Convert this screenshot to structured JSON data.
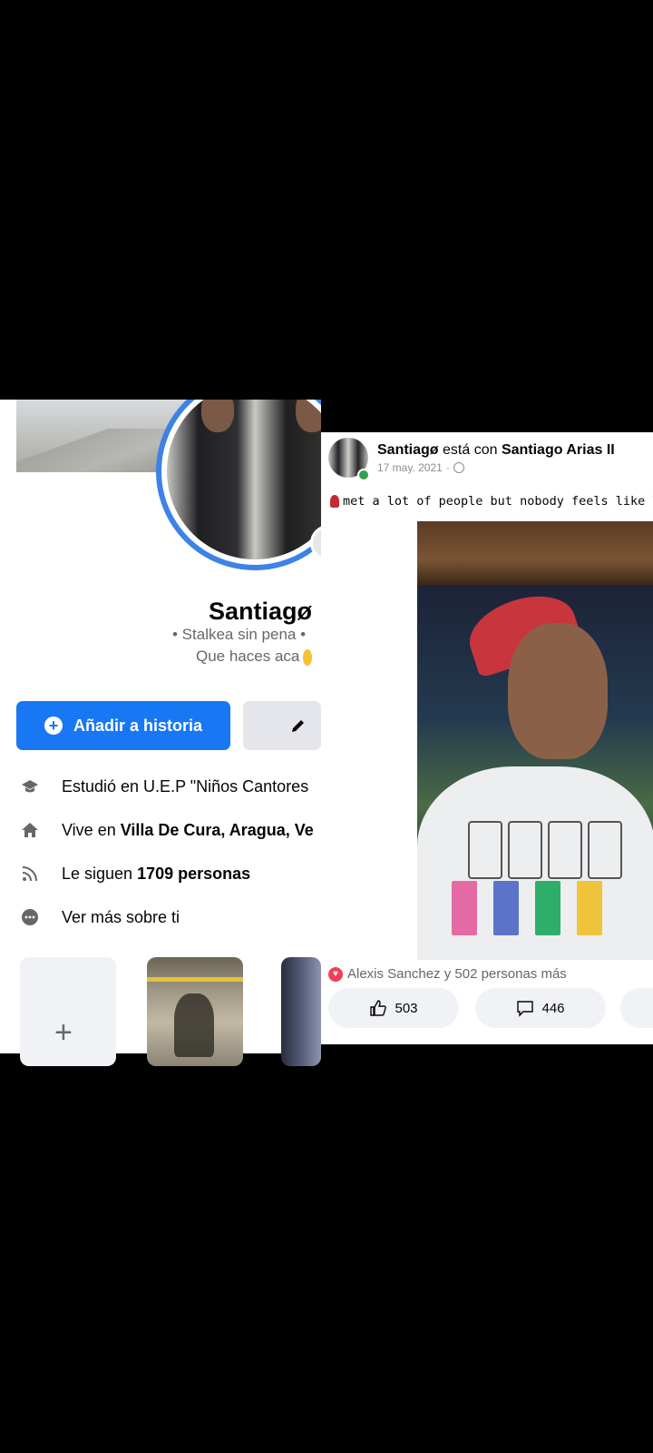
{
  "profile": {
    "name": "Santiagø",
    "bio_line1": "• Stalkea sin pena •",
    "bio_line2": "Que haces aca",
    "add_story_label": "Añadir a historia",
    "edit_label": "E",
    "info": {
      "studied": "Estudió en U.E.P \"Niños Cantores",
      "lives_prefix": "Vive en ",
      "lives_place": "Villa De Cura, Aragua, Ve",
      "followed_prefix": "Le siguen ",
      "followed_count": "1709 personas",
      "see_more": "Ver más sobre ti"
    },
    "highlight_add": "+"
  },
  "post": {
    "author": "Santiagø",
    "with_text": " está con ",
    "tagged": "Santiago Arias II",
    "date": "17 may. 2021",
    "separator": "·",
    "caption": "met a lot of people but nobody feels like Yo",
    "reactions_text": "Alexis Sanchez y 502 personas más",
    "likes": "503",
    "comments": "446"
  },
  "icons": {
    "school": "graduation-cap-icon",
    "home": "house-icon",
    "followers": "rss-feed-icon",
    "more": "ellipsis-circle-icon",
    "like": "thumbs-up-icon",
    "comment": "speech-bubble-icon",
    "privacy": "globe-icon"
  },
  "colors": {
    "accent": "#1877f2",
    "ring": "#3d82e6",
    "online": "#31a24c",
    "love": "#f33e58"
  }
}
